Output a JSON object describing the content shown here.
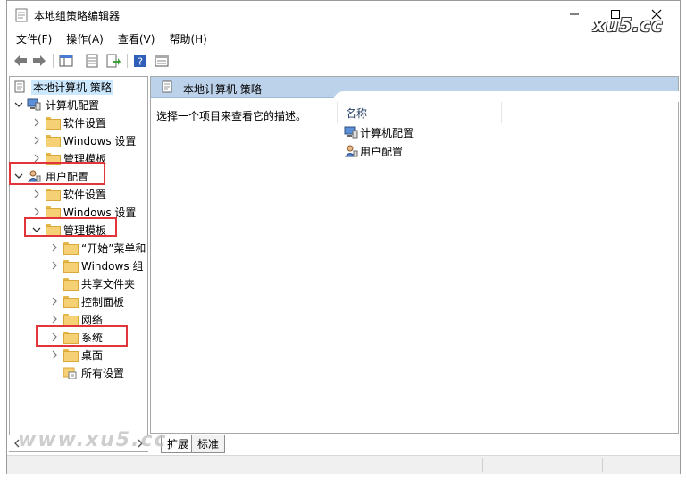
{
  "window": {
    "title": "本地组策略编辑器",
    "watermark_top": "xu5.cc",
    "watermark_bottom": "www.xu5.cc"
  },
  "menu": [
    "文件(F)",
    "操作(A)",
    "查看(V)",
    "帮助(H)"
  ],
  "toolbar": {
    "icons": [
      "back-arrow-icon",
      "forward-arrow-icon",
      "show-hide-tree-icon",
      "properties-icon",
      "export-list-icon",
      "help-icon",
      "extended-view-icon"
    ]
  },
  "tree": {
    "root": "本地计算机 策略",
    "computer_config": "计算机配置",
    "computer_children": [
      "软件设置",
      "Windows 设置",
      "管理模板"
    ],
    "user_config": "用户配置",
    "user_children": [
      "软件设置",
      "Windows 设置"
    ],
    "admin_templates": "管理模板",
    "admin_children": [
      "“开始”菜单和",
      "Windows 组",
      "共享文件夹",
      "控制面板",
      "网络",
      "系统",
      "桌面",
      "所有设置"
    ]
  },
  "right_pane": {
    "header": "本地计算机 策略",
    "description": "选择一个项目来查看它的描述。",
    "column_name": "名称",
    "items": [
      "计算机配置",
      "用户配置"
    ]
  },
  "tabs": [
    "扩展",
    "标准"
  ],
  "colors": {
    "highlight": "#e2353b",
    "header_bg": "#bcd2ea",
    "selected_bg": "#cce8ff"
  }
}
